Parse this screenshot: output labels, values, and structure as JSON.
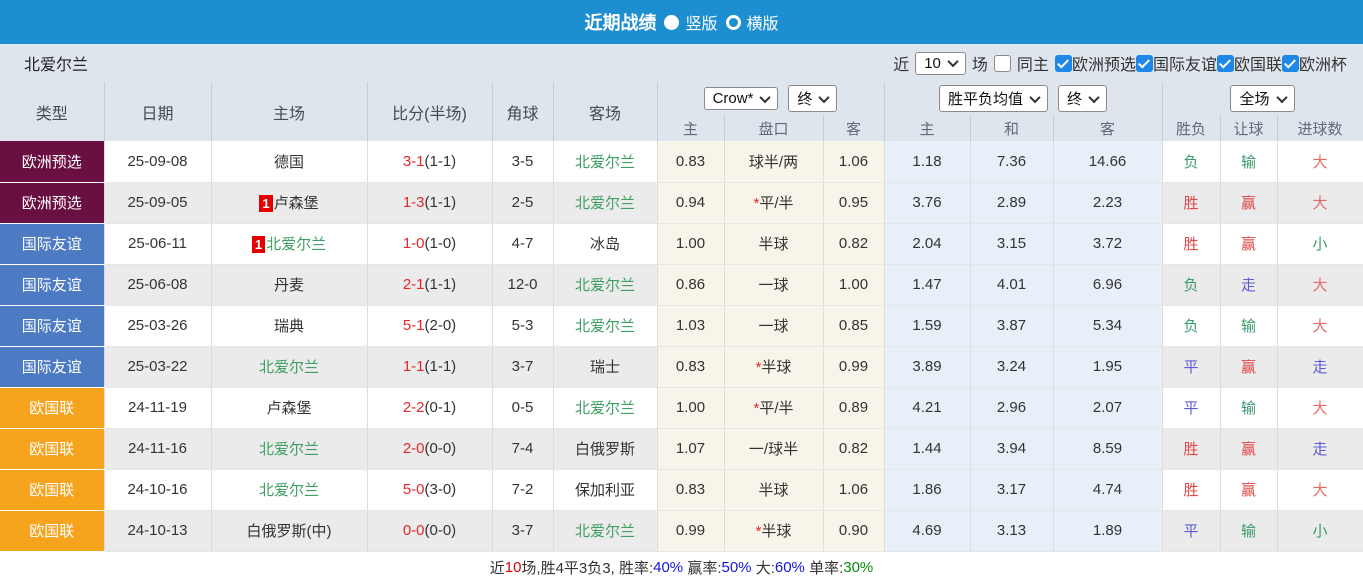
{
  "topbar": {
    "title": "近期战绩",
    "radio_vertical": "竖版",
    "radio_horizontal": "横版"
  },
  "filterbar": {
    "team": "北爱尔兰",
    "near_label": "近",
    "count_value": "10",
    "games_label": "场",
    "same_home_label": "同主",
    "competitions": [
      "欧洲预选",
      "国际友谊",
      "欧国联",
      "欧洲杯"
    ]
  },
  "table": {
    "left_headers": [
      "类型",
      "日期",
      "主场",
      "比分(半场)",
      "角球",
      "客场"
    ],
    "group_crow": {
      "select": "Crow*",
      "period_select": "终",
      "subs": [
        "主",
        "盘口",
        "客"
      ]
    },
    "group_avg": {
      "select": "胜平负均值",
      "period_select": "终",
      "subs": [
        "主",
        "和",
        "客"
      ]
    },
    "group_full": {
      "select": "全场",
      "subs": [
        "胜负",
        "让球",
        "进球数"
      ]
    },
    "type_colors": {
      "欧洲预选": "#690f41",
      "国际友谊": "#4c7bc4",
      "欧国联": "#f6a31e"
    },
    "value_colors": {
      "胜": "c-red",
      "负": "c-green",
      "平": "c-blue",
      "赢": "c-red",
      "输": "c-green",
      "走": "c-blue",
      "大": "c-lred",
      "小": "c-green"
    },
    "highlight_team": "北爱尔兰",
    "rows": [
      {
        "type": "欧洲预选",
        "date": "25-09-08",
        "home": "德国",
        "home_badge": "",
        "score": "3-1",
        "half": "(1-1)",
        "corner": "3-5",
        "away": "北爱尔兰",
        "crow": [
          "0.83",
          "球半/两",
          "1.06"
        ],
        "avg": [
          "1.18",
          "7.36",
          "14.66"
        ],
        "results": [
          "负",
          "输",
          "大"
        ]
      },
      {
        "type": "欧洲预选",
        "date": "25-09-05",
        "home": "卢森堡",
        "home_badge": "1",
        "score": "1-3",
        "half": "(1-1)",
        "corner": "2-5",
        "away": "北爱尔兰",
        "crow": [
          "0.94",
          "*平/半",
          "0.95"
        ],
        "avg": [
          "3.76",
          "2.89",
          "2.23"
        ],
        "results": [
          "胜",
          "赢",
          "大"
        ]
      },
      {
        "type": "国际友谊",
        "date": "25-06-11",
        "home": "北爱尔兰",
        "home_badge": "1",
        "score": "1-0",
        "half": "(1-0)",
        "corner": "4-7",
        "away": "冰岛",
        "crow": [
          "1.00",
          "半球",
          "0.82"
        ],
        "avg": [
          "2.04",
          "3.15",
          "3.72"
        ],
        "results": [
          "胜",
          "赢",
          "小"
        ]
      },
      {
        "type": "国际友谊",
        "date": "25-06-08",
        "home": "丹麦",
        "home_badge": "",
        "score": "2-1",
        "half": "(1-1)",
        "corner": "12-0",
        "away": "北爱尔兰",
        "crow": [
          "0.86",
          "一球",
          "1.00"
        ],
        "avg": [
          "1.47",
          "4.01",
          "6.96"
        ],
        "results": [
          "负",
          "走",
          "大"
        ]
      },
      {
        "type": "国际友谊",
        "date": "25-03-26",
        "home": "瑞典",
        "home_badge": "",
        "score": "5-1",
        "half": "(2-0)",
        "corner": "5-3",
        "away": "北爱尔兰",
        "crow": [
          "1.03",
          "一球",
          "0.85"
        ],
        "avg": [
          "1.59",
          "3.87",
          "5.34"
        ],
        "results": [
          "负",
          "输",
          "大"
        ]
      },
      {
        "type": "国际友谊",
        "date": "25-03-22",
        "home": "北爱尔兰",
        "home_badge": "",
        "score": "1-1",
        "half": "(1-1)",
        "corner": "3-7",
        "away": "瑞士",
        "crow": [
          "0.83",
          "*半球",
          "0.99"
        ],
        "avg": [
          "3.89",
          "3.24",
          "1.95"
        ],
        "results": [
          "平",
          "赢",
          "走"
        ]
      },
      {
        "type": "欧国联",
        "date": "24-11-19",
        "home": "卢森堡",
        "home_badge": "",
        "score": "2-2",
        "half": "(0-1)",
        "corner": "0-5",
        "away": "北爱尔兰",
        "crow": [
          "1.00",
          "*平/半",
          "0.89"
        ],
        "avg": [
          "4.21",
          "2.96",
          "2.07"
        ],
        "results": [
          "平",
          "输",
          "大"
        ]
      },
      {
        "type": "欧国联",
        "date": "24-11-16",
        "home": "北爱尔兰",
        "home_badge": "",
        "score": "2-0",
        "half": "(0-0)",
        "corner": "7-4",
        "away": "白俄罗斯",
        "crow": [
          "1.07",
          "一/球半",
          "0.82"
        ],
        "avg": [
          "1.44",
          "3.94",
          "8.59"
        ],
        "results": [
          "胜",
          "赢",
          "走"
        ]
      },
      {
        "type": "欧国联",
        "date": "24-10-16",
        "home": "北爱尔兰",
        "home_badge": "",
        "score": "5-0",
        "half": "(3-0)",
        "corner": "7-2",
        "away": "保加利亚",
        "crow": [
          "0.83",
          "半球",
          "1.06"
        ],
        "avg": [
          "1.86",
          "3.17",
          "4.74"
        ],
        "results": [
          "胜",
          "赢",
          "大"
        ]
      },
      {
        "type": "欧国联",
        "date": "24-10-13",
        "home": "白俄罗斯(中)",
        "home_badge": "",
        "score": "0-0",
        "half": "(0-0)",
        "corner": "3-7",
        "away": "北爱尔兰",
        "crow": [
          "0.99",
          "*半球",
          "0.90"
        ],
        "avg": [
          "4.69",
          "3.13",
          "1.89"
        ],
        "results": [
          "平",
          "输",
          "小"
        ]
      }
    ]
  },
  "footer": {
    "segments": [
      {
        "text": "近",
        "color": "f-dark"
      },
      {
        "text": "10",
        "color": "f-red"
      },
      {
        "text": "场,胜4平3负3, 胜率:",
        "color": "f-dark"
      },
      {
        "text": "40%",
        "color": "f-blue"
      },
      {
        "text": " 赢率:",
        "color": "f-dark"
      },
      {
        "text": "50%",
        "color": "f-blue"
      },
      {
        "text": " 大:",
        "color": "f-dark"
      },
      {
        "text": "60%",
        "color": "f-blue"
      },
      {
        "text": " 单率:",
        "color": "f-dark"
      },
      {
        "text": "30%",
        "color": "f-green"
      }
    ]
  }
}
